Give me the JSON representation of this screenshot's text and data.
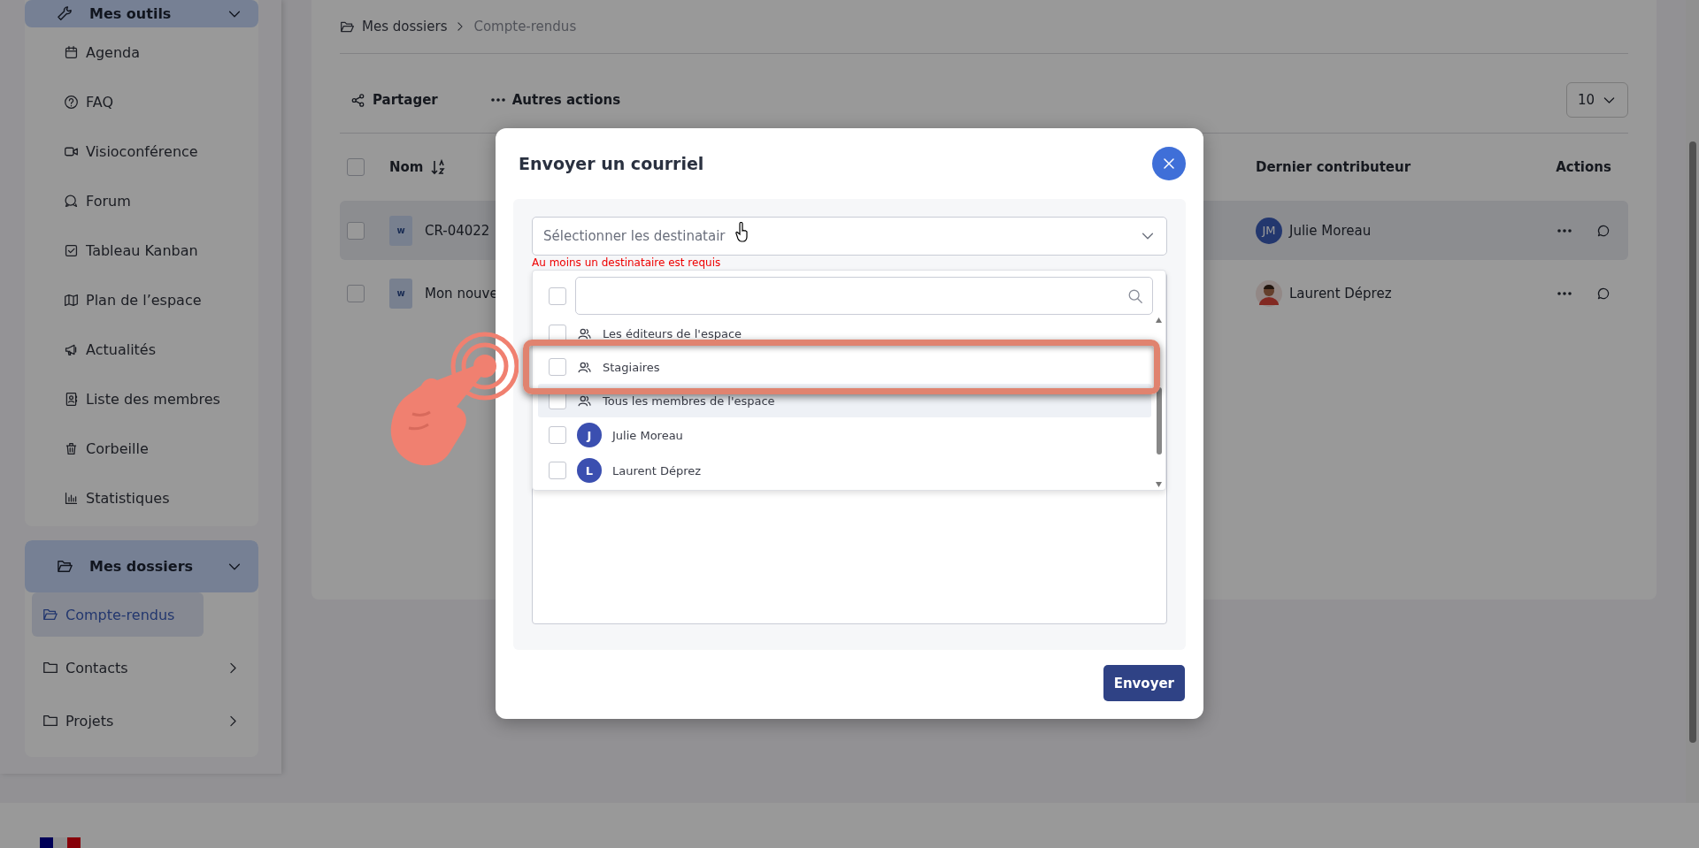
{
  "sidebar": {
    "tools_header": {
      "label": "Mes outils",
      "expanded": true
    },
    "tools": [
      {
        "label": "Agenda"
      },
      {
        "label": "FAQ"
      },
      {
        "label": "Visioconférence"
      },
      {
        "label": "Forum"
      },
      {
        "label": "Tableau Kanban"
      },
      {
        "label": "Plan de l’espace"
      },
      {
        "label": "Actualités"
      },
      {
        "label": "Liste des membres"
      },
      {
        "label": "Corbeille"
      },
      {
        "label": "Statistiques"
      }
    ],
    "folders_header": {
      "label": "Mes dossiers",
      "expanded": true
    },
    "folders": [
      {
        "label": "Compte-rendus",
        "selected": true,
        "has_children": false
      },
      {
        "label": "Contacts",
        "selected": false,
        "has_children": true
      },
      {
        "label": "Projets",
        "selected": false,
        "has_children": true
      }
    ]
  },
  "breadcrumb": [
    "Mes dossiers",
    "Compte-rendus"
  ],
  "toolbar": {
    "actions": [
      {
        "label": "Partager"
      },
      {
        "label": "Autres actions"
      }
    ],
    "page_size": "10"
  },
  "table": {
    "all_checked": false,
    "columns": [
      "Nom",
      "Dernier contributeur",
      "Actions"
    ],
    "rows": [
      {
        "file_type": "w",
        "name": "CR-04022",
        "contributor": "Julie Moreau",
        "kind": "initials",
        "initials": "JM",
        "checked": false,
        "hovered": true
      },
      {
        "file_type": "w",
        "name": "Mon nouve",
        "contributor": "Laurent Déprez",
        "kind": "photo",
        "checked": false,
        "hovered": false
      }
    ]
  },
  "dialog": {
    "title": "Envoyer un courriel",
    "select_placeholder": "Sélectionner les destinatair",
    "error": "Au moins un destinataire est requis",
    "select_all_checked": false,
    "options": [
      {
        "kind": "group",
        "label": "Les éditeurs de l'espace",
        "checked": false,
        "hovered": false,
        "callout": false
      },
      {
        "kind": "group",
        "label": "Stagiaires",
        "checked": false,
        "hovered": false,
        "callout": true
      },
      {
        "kind": "group",
        "label": "Tous les membres de l'espace",
        "checked": false,
        "hovered": true,
        "callout": false
      },
      {
        "kind": "person",
        "label": "Julie Moreau",
        "initial": "J",
        "checked": false,
        "hovered": false,
        "callout": false
      },
      {
        "kind": "person",
        "label": "Laurent Déprez",
        "initial": "L",
        "checked": false,
        "hovered": false,
        "callout": false
      }
    ],
    "send": "Envoyer"
  }
}
